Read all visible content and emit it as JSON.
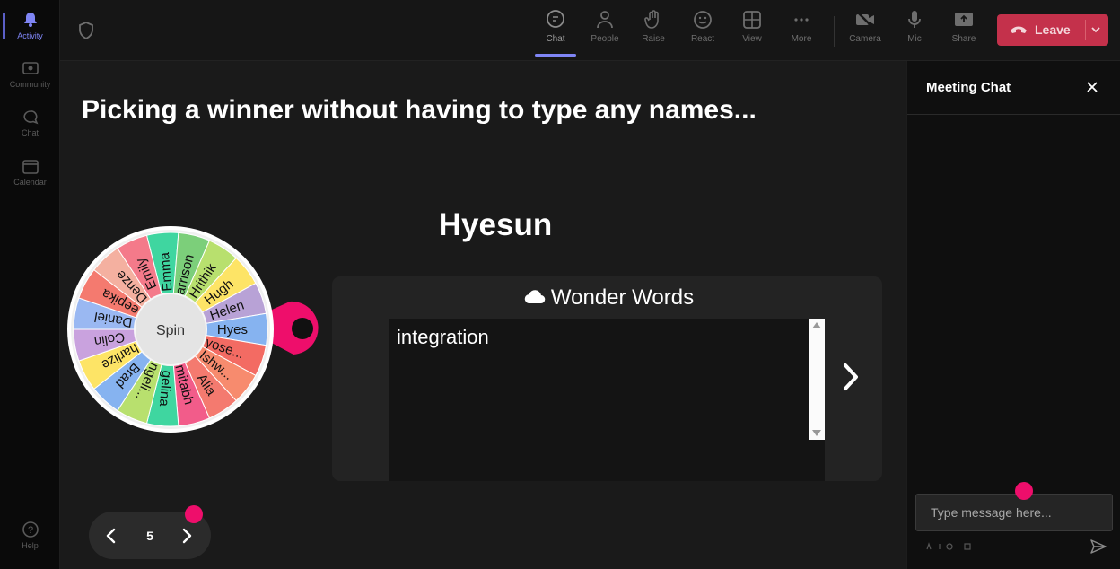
{
  "rail": {
    "items": [
      {
        "label": "Activity",
        "icon": "bell-icon",
        "active": true
      },
      {
        "label": "Community",
        "icon": "community-icon",
        "active": false
      },
      {
        "label": "Chat",
        "icon": "chat-icon",
        "active": false
      },
      {
        "label": "Calendar",
        "icon": "calendar-icon",
        "active": false
      }
    ],
    "help_label": "Help"
  },
  "toolbar": {
    "chat": "Chat",
    "people": "People",
    "raise": "Raise",
    "react": "React",
    "view": "View",
    "more": "More",
    "camera": "Camera",
    "mic": "Mic",
    "share": "Share",
    "leave": "Leave"
  },
  "stage": {
    "headline": "Picking a winner without having to type any names...",
    "winner": "Hyesun",
    "wheel": {
      "center_label": "Spin",
      "segments": [
        "Emma",
        "Harrison",
        "Hrithik",
        "Hugh",
        "Helen",
        "Hyesun",
        "Hyose...",
        "Ishw...",
        "Alia",
        "Amitabh",
        "Angelina",
        "Angeli...",
        "Brad",
        "Charlize",
        "Colin",
        "Daniel",
        "Deepika",
        "Denzel",
        "Emily"
      ],
      "segment_labels": [
        "Emma",
        "Harrison",
        "Hrithik",
        "Hugh",
        "Helen",
        "Hyes",
        "Hyose...",
        "Ishw...",
        "Alia",
        "mitabh",
        "gelina",
        "ngeli...",
        "Brad",
        "harlize",
        "Colin",
        "Daniel",
        "Deepika",
        "Denze",
        "Emily"
      ],
      "colors": [
        "#3fd6a0",
        "#7ccf7a",
        "#b8e06e",
        "#fde466",
        "#b8a2d6",
        "#86b3f0",
        "#f36b63",
        "#f78b6e",
        "#f47a6f",
        "#f25c8a",
        "#3fd6a0",
        "#b8e06e",
        "#86b3f0",
        "#fde466",
        "#c9a2de",
        "#9ab8f2",
        "#f47a6f",
        "#f4b0a0",
        "#f47a8a"
      ],
      "pointer_color": "#ee0e6b"
    },
    "wonder_words": {
      "title": "Wonder Words",
      "text": "integration"
    },
    "pager": {
      "page": "5"
    }
  },
  "chat": {
    "title": "Meeting Chat",
    "placeholder": "Type message here..."
  },
  "colors": {
    "accent": "#7f85f5",
    "leave": "#c4314b",
    "pink": "#ee0e6b"
  }
}
